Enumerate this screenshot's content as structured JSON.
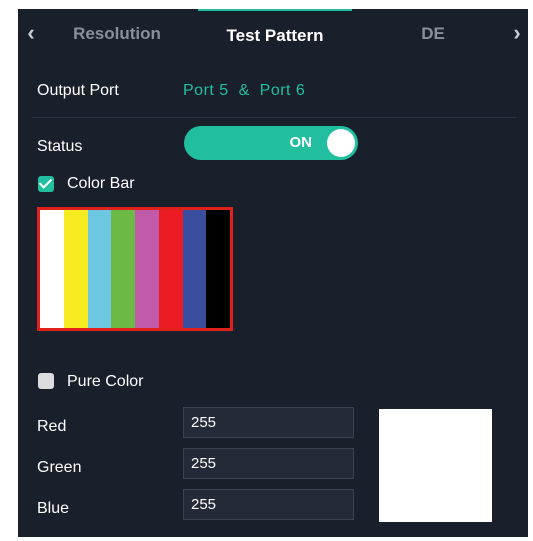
{
  "tabs": {
    "left_arrow": "‹",
    "right_arrow": "›",
    "items": [
      {
        "label": "Resolution"
      },
      {
        "label": "Test Pattern"
      },
      {
        "label": "DE"
      }
    ]
  },
  "output_port": {
    "label": "Output Port",
    "value": "Port 5  &  Port 6"
  },
  "status": {
    "label": "Status",
    "toggle_text": "ON"
  },
  "color_bar": {
    "label": "Color Bar",
    "checked": true,
    "bar_colors": [
      "#ffffff",
      "#f7ec22",
      "#6bc8e0",
      "#6cba45",
      "#c05aa9",
      "#ec1c24",
      "#3a4ea0",
      "#000000"
    ]
  },
  "pure_color": {
    "label": "Pure Color",
    "checked": false,
    "red_label": "Red",
    "red_value": "255",
    "green_label": "Green",
    "green_value": "255",
    "blue_label": "Blue",
    "blue_value": "255",
    "swatch_color": "#ffffff"
  },
  "colors": {
    "accent": "#21bfa0",
    "panel_bg": "#1a1f2c",
    "bar_border": "#e0201b"
  }
}
